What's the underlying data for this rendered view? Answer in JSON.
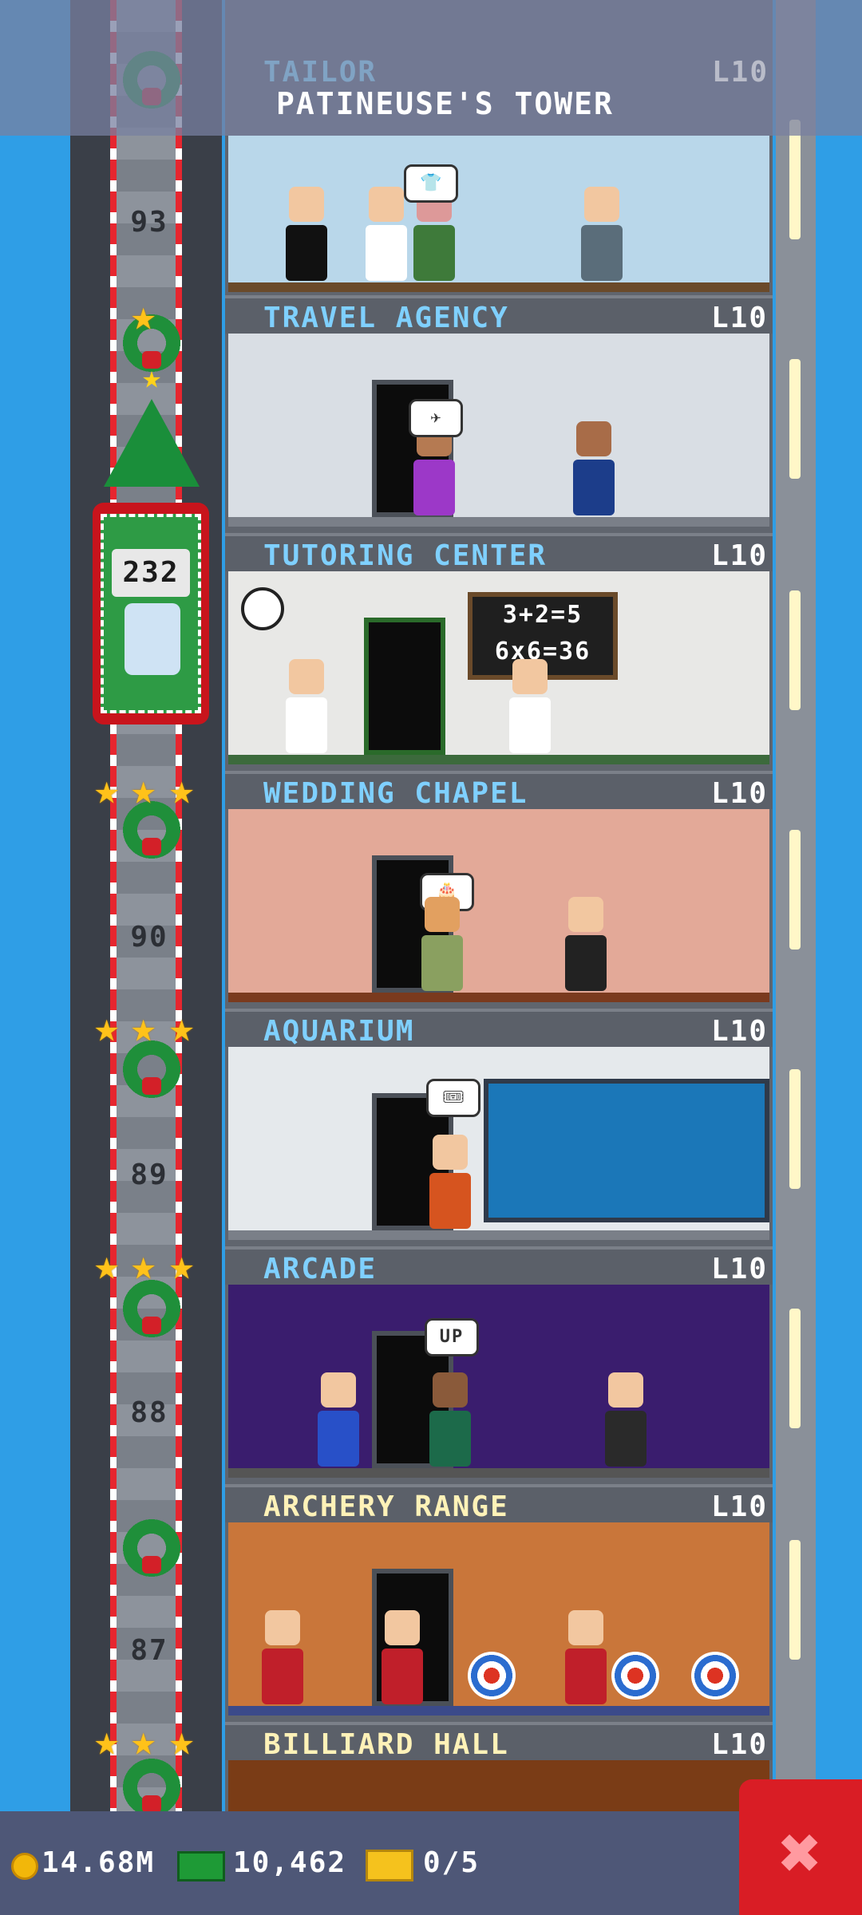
{
  "tower": {
    "name": "PATINEUSE'S TOWER",
    "top_partial_floor": {
      "name": "TAILOR",
      "level": "L10"
    }
  },
  "floors": [
    {
      "name": "TRAVEL AGENCY",
      "level": "L10"
    },
    {
      "name": "TUTORING CENTER",
      "level": "L10"
    },
    {
      "name": "WEDDING CHAPEL",
      "level": "L10"
    },
    {
      "name": "AQUARIUM",
      "level": "L10"
    },
    {
      "name": "ARCADE",
      "level": "L10"
    },
    {
      "name": "ARCHERY RANGE",
      "level": "L10"
    },
    {
      "name": "BILLIARD HALL",
      "level": "L10"
    }
  ],
  "shaft_floor_numbers": [
    "93",
    "90",
    "89",
    "88",
    "87"
  ],
  "elevator": {
    "counter": "232"
  },
  "tutoring_board": {
    "line1": "3+2=5",
    "line2": "6x6=36"
  },
  "bubbles": {
    "arcade_up": "UP"
  },
  "currency": {
    "coins": "14.68M",
    "bux": "10,462",
    "tickets": "0/5"
  },
  "colors": {
    "label_text": "#7fd0ff",
    "level_text": "#ffffff",
    "close_button": "#d91d25",
    "background": "#2f9ee6"
  },
  "icons": {
    "close": "close-icon",
    "coin": "coin-icon",
    "bux": "bux-icon",
    "ticket": "ticket-icon"
  }
}
